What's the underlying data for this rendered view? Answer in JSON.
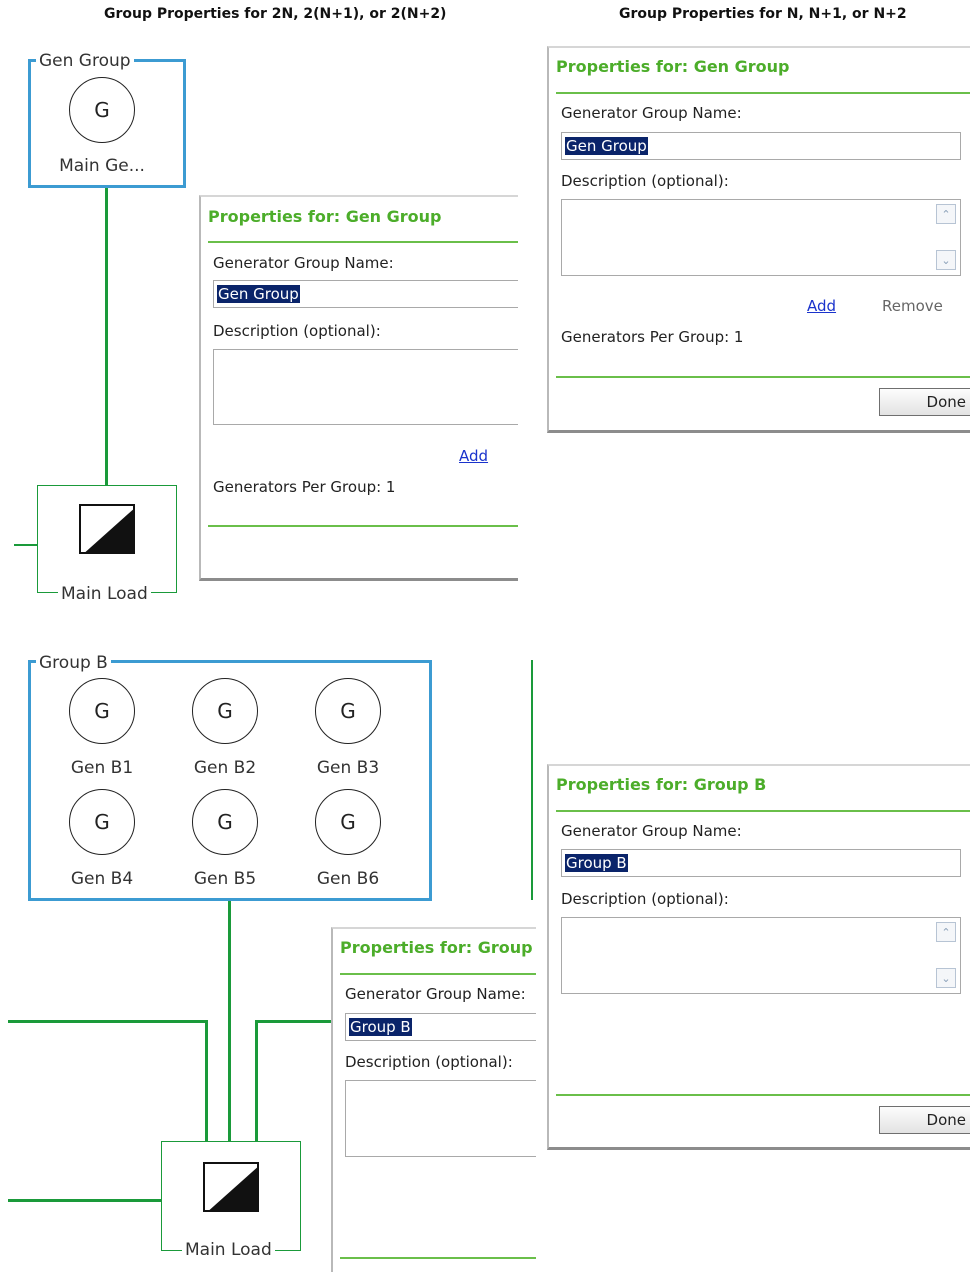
{
  "headings": {
    "left": "Group Properties for 2N, 2(N+1), or 2(N+2)",
    "right": "Group Properties for N, N+1, or N+2"
  },
  "diagram_top": {
    "group_title": "Gen Group",
    "generator": {
      "symbol": "G",
      "label": "Main Ge..."
    },
    "load_label": "Main Load"
  },
  "diagram_bottom": {
    "group_title": "Group B",
    "generators": [
      {
        "symbol": "G",
        "label": "Gen B1"
      },
      {
        "symbol": "G",
        "label": "Gen B2"
      },
      {
        "symbol": "G",
        "label": "Gen B3"
      },
      {
        "symbol": "G",
        "label": "Gen B4"
      },
      {
        "symbol": "G",
        "label": "Gen B5"
      },
      {
        "symbol": "G",
        "label": "Gen B6"
      }
    ],
    "load_label": "Main Load"
  },
  "panel_top_left": {
    "title": "Properties for: Gen Group",
    "name_label": "Generator Group Name:",
    "name_value": "Gen Group",
    "desc_label": "Description (optional):",
    "add_link": "Add",
    "per_group": "Generators Per Group: 1"
  },
  "panel_top_right": {
    "title": "Properties for: Gen Group",
    "name_label": "Generator Group Name:",
    "name_value": "Gen Group",
    "desc_label": "Description (optional):",
    "add_link": "Add",
    "remove_link": "Remove",
    "per_group": "Generators Per Group: 1",
    "done": "Done"
  },
  "panel_bottom_left": {
    "title": "Properties for: Group B",
    "name_label": "Generator Group Name:",
    "name_value": "Group B",
    "desc_label": "Description (optional):"
  },
  "panel_bottom_right": {
    "title": "Properties for: Group B",
    "name_label": "Generator Group Name:",
    "name_value": "Group B",
    "desc_label": "Description (optional):",
    "done": "Done"
  },
  "colors": {
    "line_green": "#1a9a3a",
    "group_blue": "#3c9bd2",
    "title_green": "#4cad2a",
    "selection": "#0a246a",
    "link": "#1a33cc"
  },
  "icons": {
    "scroll_up": "chevron-up-icon",
    "scroll_down": "chevron-down-icon",
    "load": "load-icon"
  }
}
